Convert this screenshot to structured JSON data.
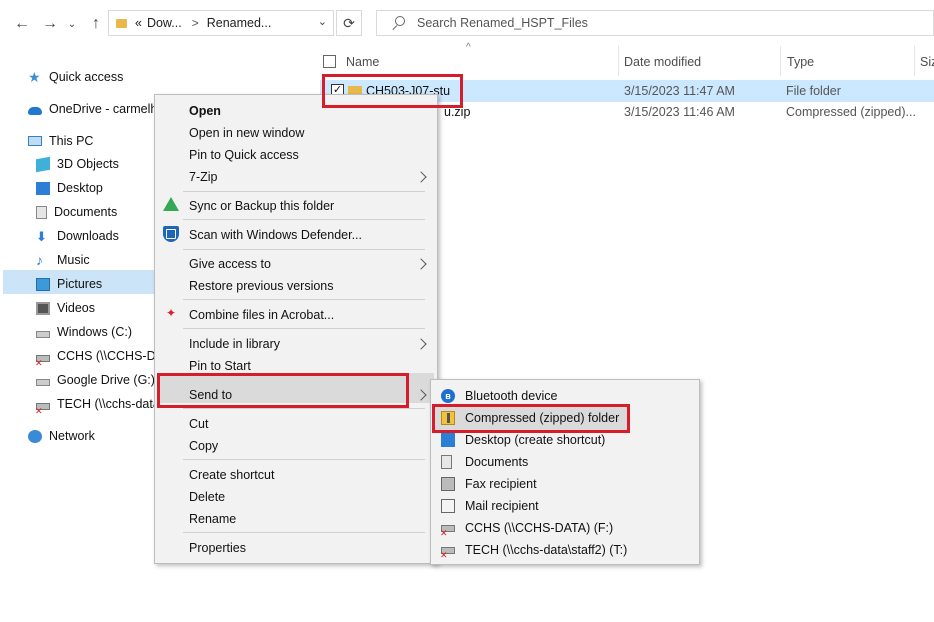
{
  "address": {
    "overflow": "«",
    "segments": [
      "Dow...",
      "Renamed..."
    ],
    "separator": ">"
  },
  "search": {
    "placeholder": "Search Renamed_HSPT_Files"
  },
  "nav": {
    "items": [
      {
        "label": "Quick access",
        "icon": "star-icon"
      },
      {
        "label": "OneDrive - carmelhs",
        "icon": "cloud-icon"
      },
      {
        "label": "This PC",
        "icon": "computer-icon"
      },
      {
        "label": "3D Objects",
        "icon": "cube-icon"
      },
      {
        "label": "Desktop",
        "icon": "desktop-icon"
      },
      {
        "label": "Documents",
        "icon": "documents-icon"
      },
      {
        "label": "Downloads",
        "icon": "download-icon",
        "selected": true
      },
      {
        "label": "Music",
        "icon": "music-icon"
      },
      {
        "label": "Pictures",
        "icon": "pictures-icon"
      },
      {
        "label": "Videos",
        "icon": "videos-icon"
      },
      {
        "label": "Windows (C:)",
        "icon": "drive-icon"
      },
      {
        "label": "CCHS (\\\\CCHS-DA",
        "icon": "network-drive-icon"
      },
      {
        "label": "Google Drive (G:)",
        "icon": "drive-icon"
      },
      {
        "label": "TECH (\\\\cchs-data",
        "icon": "network-drive-icon"
      },
      {
        "label": "Network",
        "icon": "network-icon"
      }
    ]
  },
  "columns": {
    "name": "Name",
    "date": "Date modified",
    "type": "Type",
    "size": "Siz"
  },
  "files": [
    {
      "name": "CH503-J07-stu",
      "date": "3/15/2023 11:47 AM",
      "type": "File folder",
      "selected": true
    },
    {
      "name": "u.zip",
      "date": "3/15/2023 11:46 AM",
      "type": "Compressed (zipped)..."
    }
  ],
  "context_menu": {
    "open": "Open",
    "open_new_window": "Open in new window",
    "pin_quick_access": "Pin to Quick access",
    "seven_zip": "7-Zip",
    "sync_backup": "Sync or Backup this folder",
    "scan_defender": "Scan with Windows Defender...",
    "give_access": "Give access to",
    "restore_versions": "Restore previous versions",
    "combine_acrobat": "Combine files in Acrobat...",
    "include_library": "Include in library",
    "pin_start": "Pin to Start",
    "send_to": "Send to",
    "cut": "Cut",
    "copy": "Copy",
    "create_shortcut": "Create shortcut",
    "delete": "Delete",
    "rename": "Rename",
    "properties": "Properties"
  },
  "send_to_menu": {
    "bluetooth": "Bluetooth device",
    "compressed": "Compressed (zipped) folder",
    "desktop": "Desktop (create shortcut)",
    "documents": "Documents",
    "fax": "Fax recipient",
    "mail": "Mail recipient",
    "cchs": "CCHS (\\\\CCHS-DATA) (F:)",
    "tech": "TECH (\\\\cchs-data\\staff2) (T:)"
  },
  "colors": {
    "highlight": "#d51d2b",
    "selection": "#cce8ff",
    "accent": "#1f6fd1"
  }
}
